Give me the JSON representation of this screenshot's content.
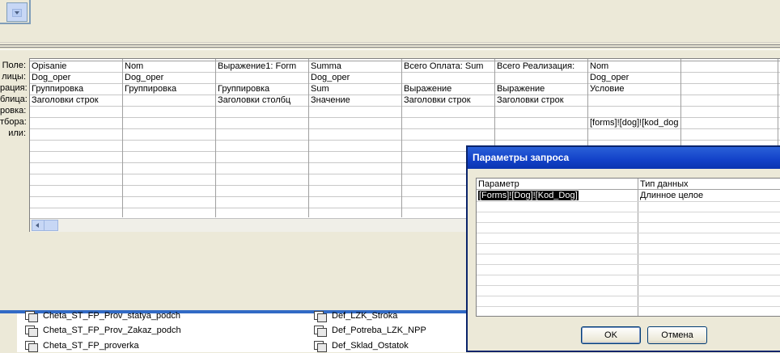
{
  "grid": {
    "row_labels": [
      "Поле:",
      "лицы:",
      "рация:",
      "блица:",
      "ровка:",
      "тбора:",
      "или:"
    ],
    "columns": [
      {
        "cells": [
          "Opisanie",
          "Dog_oper",
          "Группировка",
          "Заголовки строк",
          "",
          "",
          ""
        ]
      },
      {
        "cells": [
          "Nom",
          "Dog_oper",
          "Группировка",
          "",
          "",
          "",
          ""
        ]
      },
      {
        "cells": [
          "Выражение1: Form",
          "",
          "Группировка",
          "Заголовки столбц",
          "",
          "",
          ""
        ]
      },
      {
        "cells": [
          "Summa",
          "Dog_oper",
          "Sum",
          "Значение",
          "",
          "",
          ""
        ]
      },
      {
        "cells": [
          "Всего Оплата: Sum",
          "",
          "Выражение",
          "Заголовки строк",
          "",
          "",
          ""
        ]
      },
      {
        "cells": [
          "Всего Реализация:",
          "",
          "Выражение",
          "Заголовки строк",
          "",
          "",
          ""
        ]
      },
      {
        "cells": [
          "Nom",
          "Dog_oper",
          "Условие",
          "",
          "",
          "[forms]![dog]![kod_dog",
          ""
        ]
      },
      {
        "cells": [
          "",
          "",
          "",
          "",
          "",
          "",
          ""
        ]
      },
      {
        "cells": [
          "",
          "",
          "",
          "",
          "",
          "",
          ""
        ]
      }
    ]
  },
  "db_list": {
    "left_items": [
      "Cheta_ST_FP_Prov_statya_podch",
      "Cheta_ST_FP_Prov_Zakaz_podch",
      "Cheta_ST_FP_proverka"
    ],
    "right_items": [
      "Def_LZK_Stroka",
      "Def_Potreba_LZK_NPP",
      "Def_Sklad_Ostatok"
    ]
  },
  "dialog": {
    "title": "Параметры запроса",
    "col_param": "Параметр",
    "col_type": "Тип данных",
    "row_param": "[Forms]![Dog]![Kod_Dog]",
    "row_type": "Длинное целое",
    "ok_label": "OK",
    "cancel_label": "Отмена"
  },
  "colors": {
    "title_bar": "#1241c8",
    "window_bg": "#ece9d8",
    "selection": "#316ac5"
  }
}
